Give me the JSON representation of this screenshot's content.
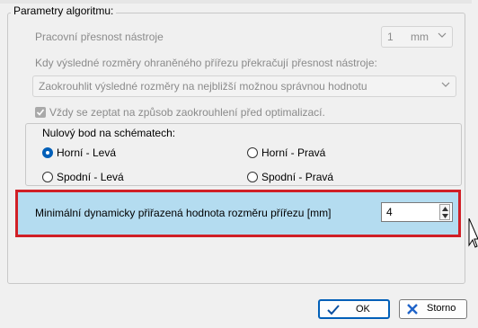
{
  "group": {
    "title": "Parametry algoritmu:"
  },
  "precision": {
    "label": "Pracovní přesnost nástroje",
    "value": "1",
    "unit": "mm"
  },
  "rounding": {
    "label": "Kdy výsledné rozměry ohraněného přířezu překračují přesnost nástroje:",
    "selected": "Zaokrouhlit výsledné rozměry na nejbližší možnou správnou hodnotu"
  },
  "always_ask": {
    "label": "Vždy se zeptat na způsob zaokrouhlení před optimalizací.",
    "checked": true
  },
  "zero_point": {
    "title": "Nulový bod na schématech:",
    "options": [
      {
        "label": "Horní - Levá",
        "checked": true
      },
      {
        "label": "Horní - Pravá",
        "checked": false
      },
      {
        "label": "Spodní - Levá",
        "checked": false
      },
      {
        "label": "Spodní - Pravá",
        "checked": false
      }
    ]
  },
  "min_dynamic": {
    "label": "Minimální dynamicky přiřazená hodnota rozměru přířezu [mm]",
    "value": "4"
  },
  "buttons": {
    "ok": "OK",
    "cancel": "Storno"
  },
  "colors": {
    "highlight_border": "#d01f26",
    "highlight_fill": "#b4dcf0",
    "accent": "#005fb8"
  }
}
